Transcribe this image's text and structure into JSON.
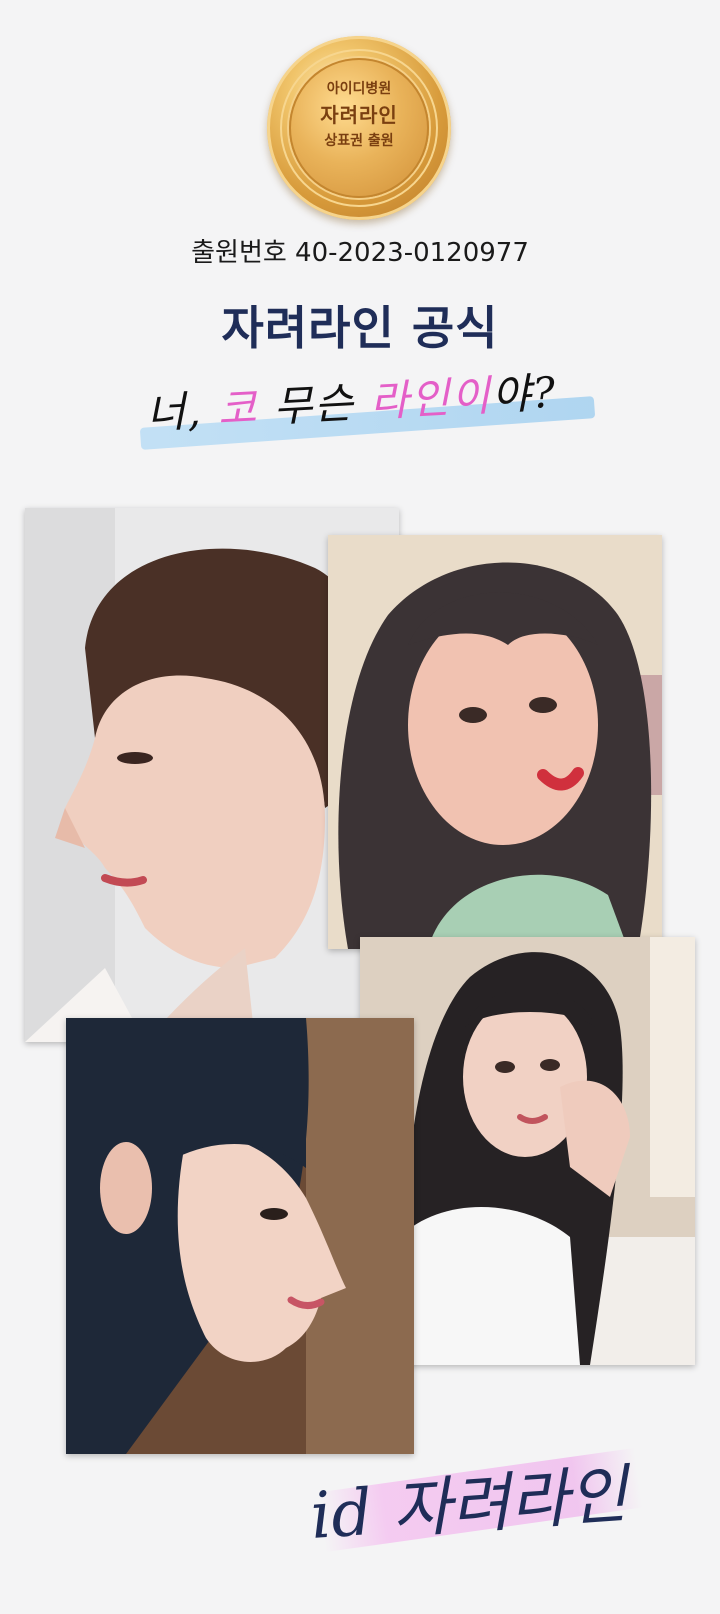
{
  "seal": {
    "line1": "아이디병원",
    "line2": "자려라인",
    "line3": "상표권 출원"
  },
  "application_number": "출원번호 40-2023-0120977",
  "title": "자려라인 공식",
  "tagline": {
    "part1": "너, ",
    "part2": "코",
    "part3": " 무슨 ",
    "part4": "라인이",
    "part5": "야?"
  },
  "signature": "id 자려라인",
  "colors": {
    "title": "#1f2d58",
    "accent_pink": "#e45fc8",
    "highlight_blue": "#bde0f5",
    "gold": "#d79a3a"
  }
}
